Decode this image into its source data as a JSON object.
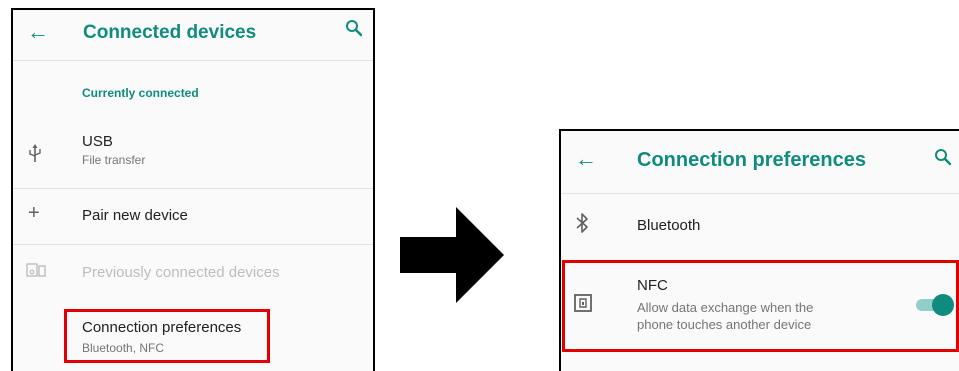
{
  "left": {
    "title": "Connected devices",
    "section_header": "Currently connected",
    "usb": {
      "title": "USB",
      "subtitle": "File transfer"
    },
    "pair": {
      "title": "Pair new device"
    },
    "previous": {
      "title": "Previously connected devices"
    },
    "conn_prefs": {
      "title": "Connection preferences",
      "subtitle": "Bluetooth, NFC"
    }
  },
  "right": {
    "title": "Connection preferences",
    "bluetooth": {
      "title": "Bluetooth"
    },
    "nfc": {
      "title": "NFC",
      "subtitle_line1": "Allow data exchange when the",
      "subtitle_line2": "phone touches another device",
      "enabled": true
    }
  },
  "colors": {
    "accent": "#0f8c7d",
    "highlight": "#e00000",
    "disabled_text": "#bdbdbd"
  },
  "icons": [
    "back-arrow-icon",
    "search-icon",
    "usb-icon",
    "plus-icon",
    "devices-icon",
    "bluetooth-icon",
    "nfc-icon",
    "right-arrow-icon"
  ]
}
